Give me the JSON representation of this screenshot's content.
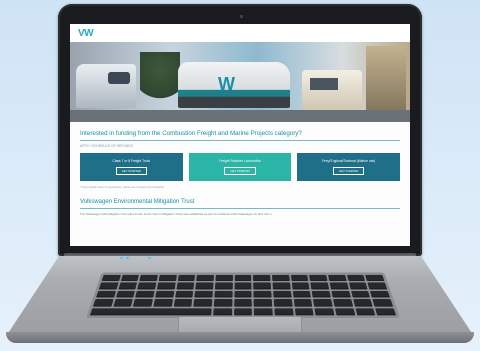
{
  "site": {
    "logo": "VW",
    "nav": [
      "",
      "",
      "",
      ""
    ]
  },
  "content": {
    "heading": "Interested in funding from the Combustion Freight and Marine Projects category?",
    "subheading": "APPLY  SCHEDULE  OF  REFUNDS",
    "tiles": [
      {
        "label": "Class 7 or 8 Freight Truck",
        "button": "GET STARTED"
      },
      {
        "label": "Freight Switcher Locomotive",
        "button": "GET STARTED"
      },
      {
        "label": "Ferry/Tugboat/Towboat (Marine use)",
        "button": "GET STARTED"
      }
    ],
    "note": "* Some details about the application, please see complete list of eligibility",
    "section_heading": "Volkswagen Environmental Mitigation Trust",
    "paragraph": "The Volkswagen (VW) Mitigation Trust (also known as the Trust or Mitigation Trust) was established as part of a settlement with Volkswagen for their role in"
  },
  "colors": {
    "accent": "#1d8ea8",
    "tile_dark": "#1f6f88",
    "tile_light": "#2ab5a6"
  },
  "hero_train_mark": "W"
}
